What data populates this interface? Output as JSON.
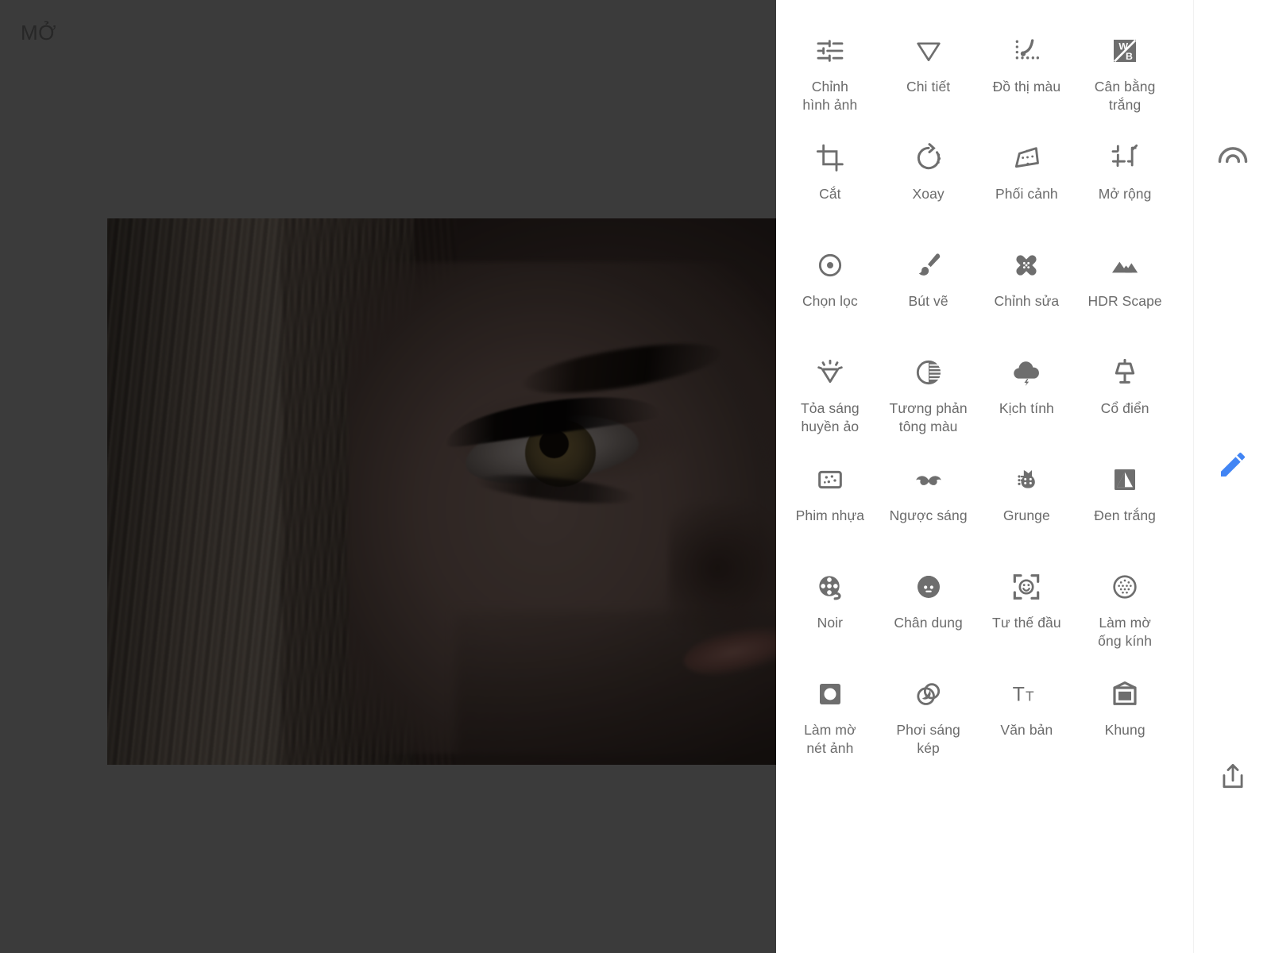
{
  "app": {
    "open_label": "MỞ"
  },
  "photo": {
    "alt_name": "close-up portrait of a blonde woman's face"
  },
  "tools": [
    {
      "label": "Chỉnh\nhình ảnh",
      "icon": "tune-icon",
      "name": "tool-tune"
    },
    {
      "label": "Chi tiết",
      "icon": "details-triangle-icon",
      "name": "tool-details"
    },
    {
      "label": "Đồ thị màu",
      "icon": "curves-icon",
      "name": "tool-curves"
    },
    {
      "label": "Cân bằng\ntrắng",
      "icon": "white-balance-icon",
      "name": "tool-white-balance"
    },
    {
      "label": "Cắt",
      "icon": "crop-icon",
      "name": "tool-crop"
    },
    {
      "label": "Xoay",
      "icon": "rotate-icon",
      "name": "tool-rotate"
    },
    {
      "label": "Phối cảnh",
      "icon": "perspective-icon",
      "name": "tool-perspective"
    },
    {
      "label": "Mở rộng",
      "icon": "expand-icon",
      "name": "tool-expand"
    },
    {
      "label": "Chọn lọc",
      "icon": "selective-icon",
      "name": "tool-selective"
    },
    {
      "label": "Bút vẽ",
      "icon": "brush-icon",
      "name": "tool-brush"
    },
    {
      "label": "Chỉnh sửa",
      "icon": "healing-bandage-icon",
      "name": "tool-healing"
    },
    {
      "label": "HDR Scape",
      "icon": "mountains-icon",
      "name": "tool-hdr-scape"
    },
    {
      "label": "Tỏa sáng\nhuyền ảo",
      "icon": "glamour-glow-icon",
      "name": "tool-glamour-glow"
    },
    {
      "label": "Tương phản\ntông màu",
      "icon": "tonal-contrast-icon",
      "name": "tool-tonal-contrast"
    },
    {
      "label": "Kịch tính",
      "icon": "drama-cloud-icon",
      "name": "tool-drama"
    },
    {
      "label": "Cổ điển",
      "icon": "vintage-lamp-icon",
      "name": "tool-vintage"
    },
    {
      "label": "Phim nhựa",
      "icon": "grainy-film-icon",
      "name": "tool-grainy-film"
    },
    {
      "label": "Ngược sáng",
      "icon": "retrolux-mustache-icon",
      "name": "tool-retrolux"
    },
    {
      "label": "Grunge",
      "icon": "grunge-cat-icon",
      "name": "tool-grunge"
    },
    {
      "label": "Đen trắng",
      "icon": "black-white-icon",
      "name": "tool-black-white"
    },
    {
      "label": "Noir",
      "icon": "film-reel-icon",
      "name": "tool-noir"
    },
    {
      "label": "Chân dung",
      "icon": "portrait-face-icon",
      "name": "tool-portrait"
    },
    {
      "label": "Tư thế đầu",
      "icon": "head-pose-icon",
      "name": "tool-head-pose"
    },
    {
      "label": "Làm mờ\nống kính",
      "icon": "lens-blur-icon",
      "name": "tool-lens-blur"
    },
    {
      "label": "Làm mờ\nnét ảnh",
      "icon": "tilt-shift-icon",
      "name": "tool-tilt-shift"
    },
    {
      "label": "Phơi sáng\nkép",
      "icon": "double-exposure-icon",
      "name": "tool-double-exposure"
    },
    {
      "label": "Văn bản",
      "icon": "text-icon",
      "name": "tool-text"
    },
    {
      "label": "Khung",
      "icon": "frames-icon",
      "name": "tool-frames"
    }
  ],
  "rail": [
    {
      "name": "looks-button",
      "icon": "looks-arc-icon",
      "color": "#757575"
    },
    {
      "name": "edit-button",
      "icon": "pencil-icon",
      "color": "#4285F4"
    },
    {
      "name": "export-button",
      "icon": "share-export-icon",
      "color": "#757575"
    }
  ],
  "colors": {
    "canvas_background": "#3b3b3b",
    "panel_background": "#ffffff",
    "icon_gray": "#6e6e6e",
    "label_gray": "#6b6b6b",
    "accent_blue": "#4285F4",
    "open_label_color": "#272727"
  }
}
